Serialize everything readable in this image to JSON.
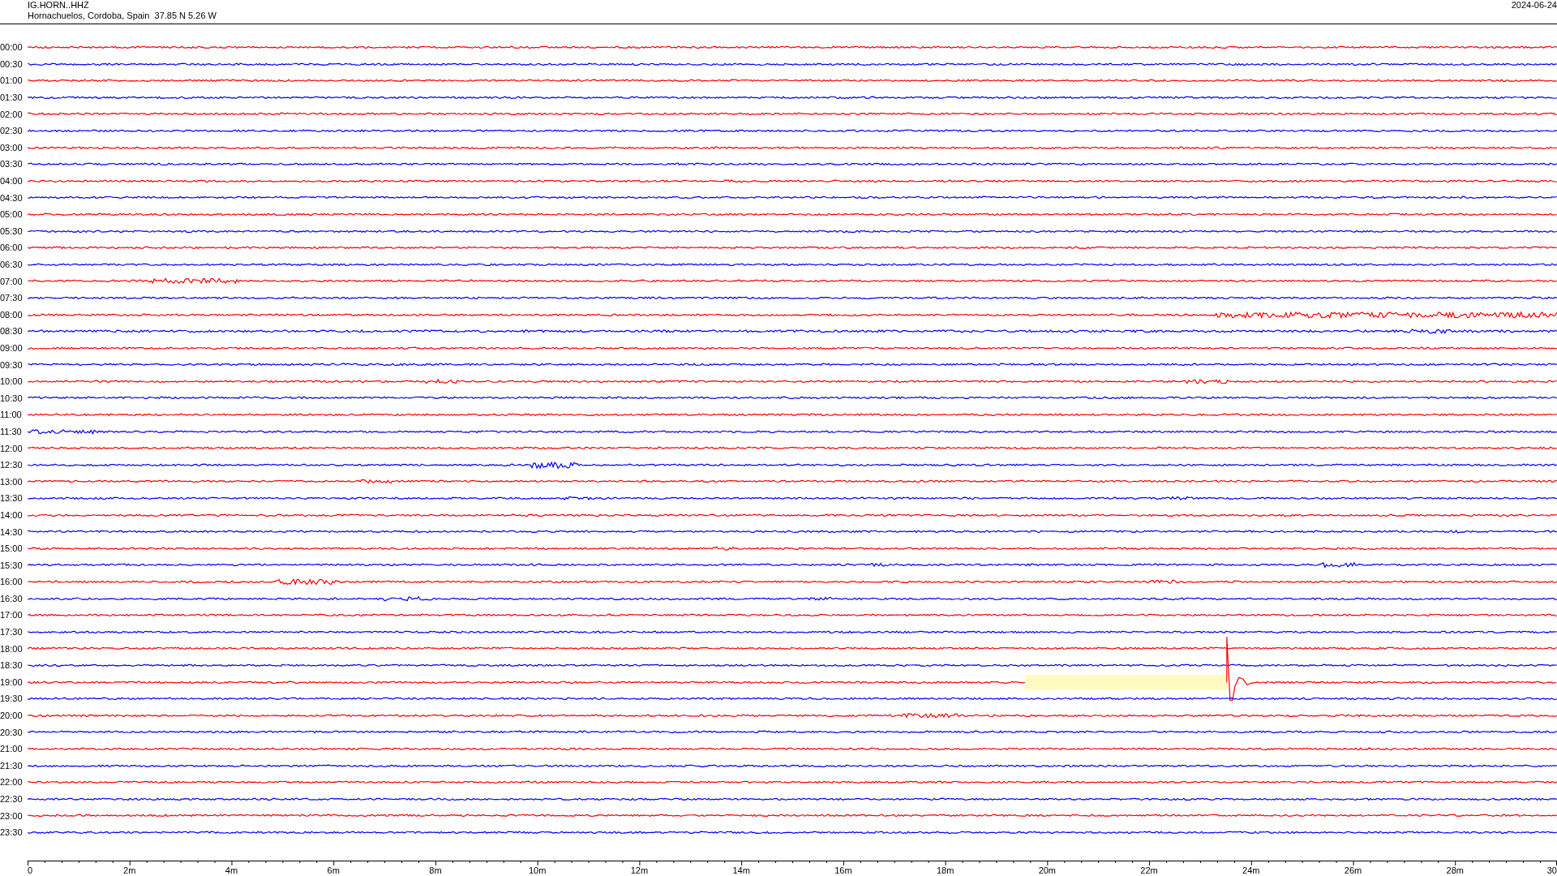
{
  "header": {
    "station": "IG.HORN..HHZ",
    "location": "Hornachuelos, Cordoba, Spain  37.85 N 5.26 W",
    "date": "2024-06-24"
  },
  "rows": [
    {
      "time": "00:00",
      "color": "#ff0000",
      "gap": false
    },
    {
      "time": "00:30",
      "color": "#0000ff",
      "gap": false
    },
    {
      "time": "01:00",
      "color": "#ff0000",
      "gap": false
    },
    {
      "time": "01:30",
      "color": "#0000ff",
      "gap": false
    },
    {
      "time": "02:00",
      "color": "#ff0000",
      "gap": false
    },
    {
      "time": "02:30",
      "color": "#0000ff",
      "gap": false
    },
    {
      "time": "03:00",
      "color": "#ff0000",
      "gap": false
    },
    {
      "time": "03:30",
      "color": "#0000ff",
      "gap": false
    },
    {
      "time": "04:00",
      "color": "#ff0000",
      "gap": false
    },
    {
      "time": "04:30",
      "color": "#0000ff",
      "gap": false
    },
    {
      "time": "05:00",
      "color": "#ff0000",
      "gap": false
    },
    {
      "time": "05:30",
      "color": "#0000ff",
      "gap": false
    },
    {
      "time": "06:00",
      "color": "#ff0000",
      "gap": false
    },
    {
      "time": "06:30",
      "color": "#0000ff",
      "gap": false
    },
    {
      "time": "07:00",
      "color": "#ff0000",
      "gap": false
    },
    {
      "time": "07:30",
      "color": "#0000ff",
      "gap": false
    },
    {
      "time": "08:00",
      "color": "#ff0000",
      "gap": false
    },
    {
      "time": "08:30",
      "color": "#0000ff",
      "gap": false
    },
    {
      "time": "09:00",
      "color": "#ff0000",
      "gap": false
    },
    {
      "time": "09:30",
      "color": "#0000ff",
      "gap": false
    },
    {
      "time": "10:00",
      "color": "#ff0000",
      "gap": false
    },
    {
      "time": "10:30",
      "color": "#0000ff",
      "gap": false
    },
    {
      "time": "11:00",
      "color": "#ff0000",
      "gap": false
    },
    {
      "time": "11:30",
      "color": "#0000ff",
      "gap": false
    },
    {
      "time": "12:00",
      "color": "#ff0000",
      "gap": false
    },
    {
      "time": "12:30",
      "color": "#0000ff",
      "gap": false
    },
    {
      "time": "13:00",
      "color": "#ff0000",
      "gap": false
    },
    {
      "time": "13:30",
      "color": "#0000ff",
      "gap": false
    },
    {
      "time": "14:00",
      "color": "#ff0000",
      "gap": false
    },
    {
      "time": "14:30",
      "color": "#0000ff",
      "gap": false
    },
    {
      "time": "15:00",
      "color": "#ff0000",
      "gap": false
    },
    {
      "time": "15:30",
      "color": "#0000ff",
      "gap": false
    },
    {
      "time": "16:00",
      "color": "#ff0000",
      "gap": false
    },
    {
      "time": "16:30",
      "color": "#0000ff",
      "gap": false
    },
    {
      "time": "17:00",
      "color": "#ff0000",
      "gap": false
    },
    {
      "time": "17:30",
      "color": "#0000ff",
      "gap": false
    },
    {
      "time": "18:00",
      "color": "#ff0000",
      "gap": false
    },
    {
      "time": "18:30",
      "color": "#0000ff",
      "gap": false
    },
    {
      "time": "19:00",
      "color": "#ff0000",
      "gap": true
    },
    {
      "time": "19:30",
      "color": "#0000ff",
      "gap": false
    },
    {
      "time": "20:00",
      "color": "#ff0000",
      "gap": false
    },
    {
      "time": "20:30",
      "color": "#0000ff",
      "gap": false
    },
    {
      "time": "21:00",
      "color": "#ff0000",
      "gap": false
    },
    {
      "time": "21:30",
      "color": "#0000ff",
      "gap": false
    },
    {
      "time": "22:00",
      "color": "#ff0000",
      "gap": false
    },
    {
      "time": "22:30",
      "color": "#0000ff",
      "gap": false
    },
    {
      "time": "23:00",
      "color": "#ff0000",
      "gap": false
    },
    {
      "time": "23:30",
      "color": "#0000ff",
      "gap": false
    }
  ],
  "axis_labels": [
    "0",
    "2m",
    "4m",
    "6m",
    "8m",
    "10m",
    "12m",
    "14m",
    "16m",
    "18m",
    "20m",
    "22m",
    "24m",
    "26m",
    "28m",
    "30"
  ]
}
